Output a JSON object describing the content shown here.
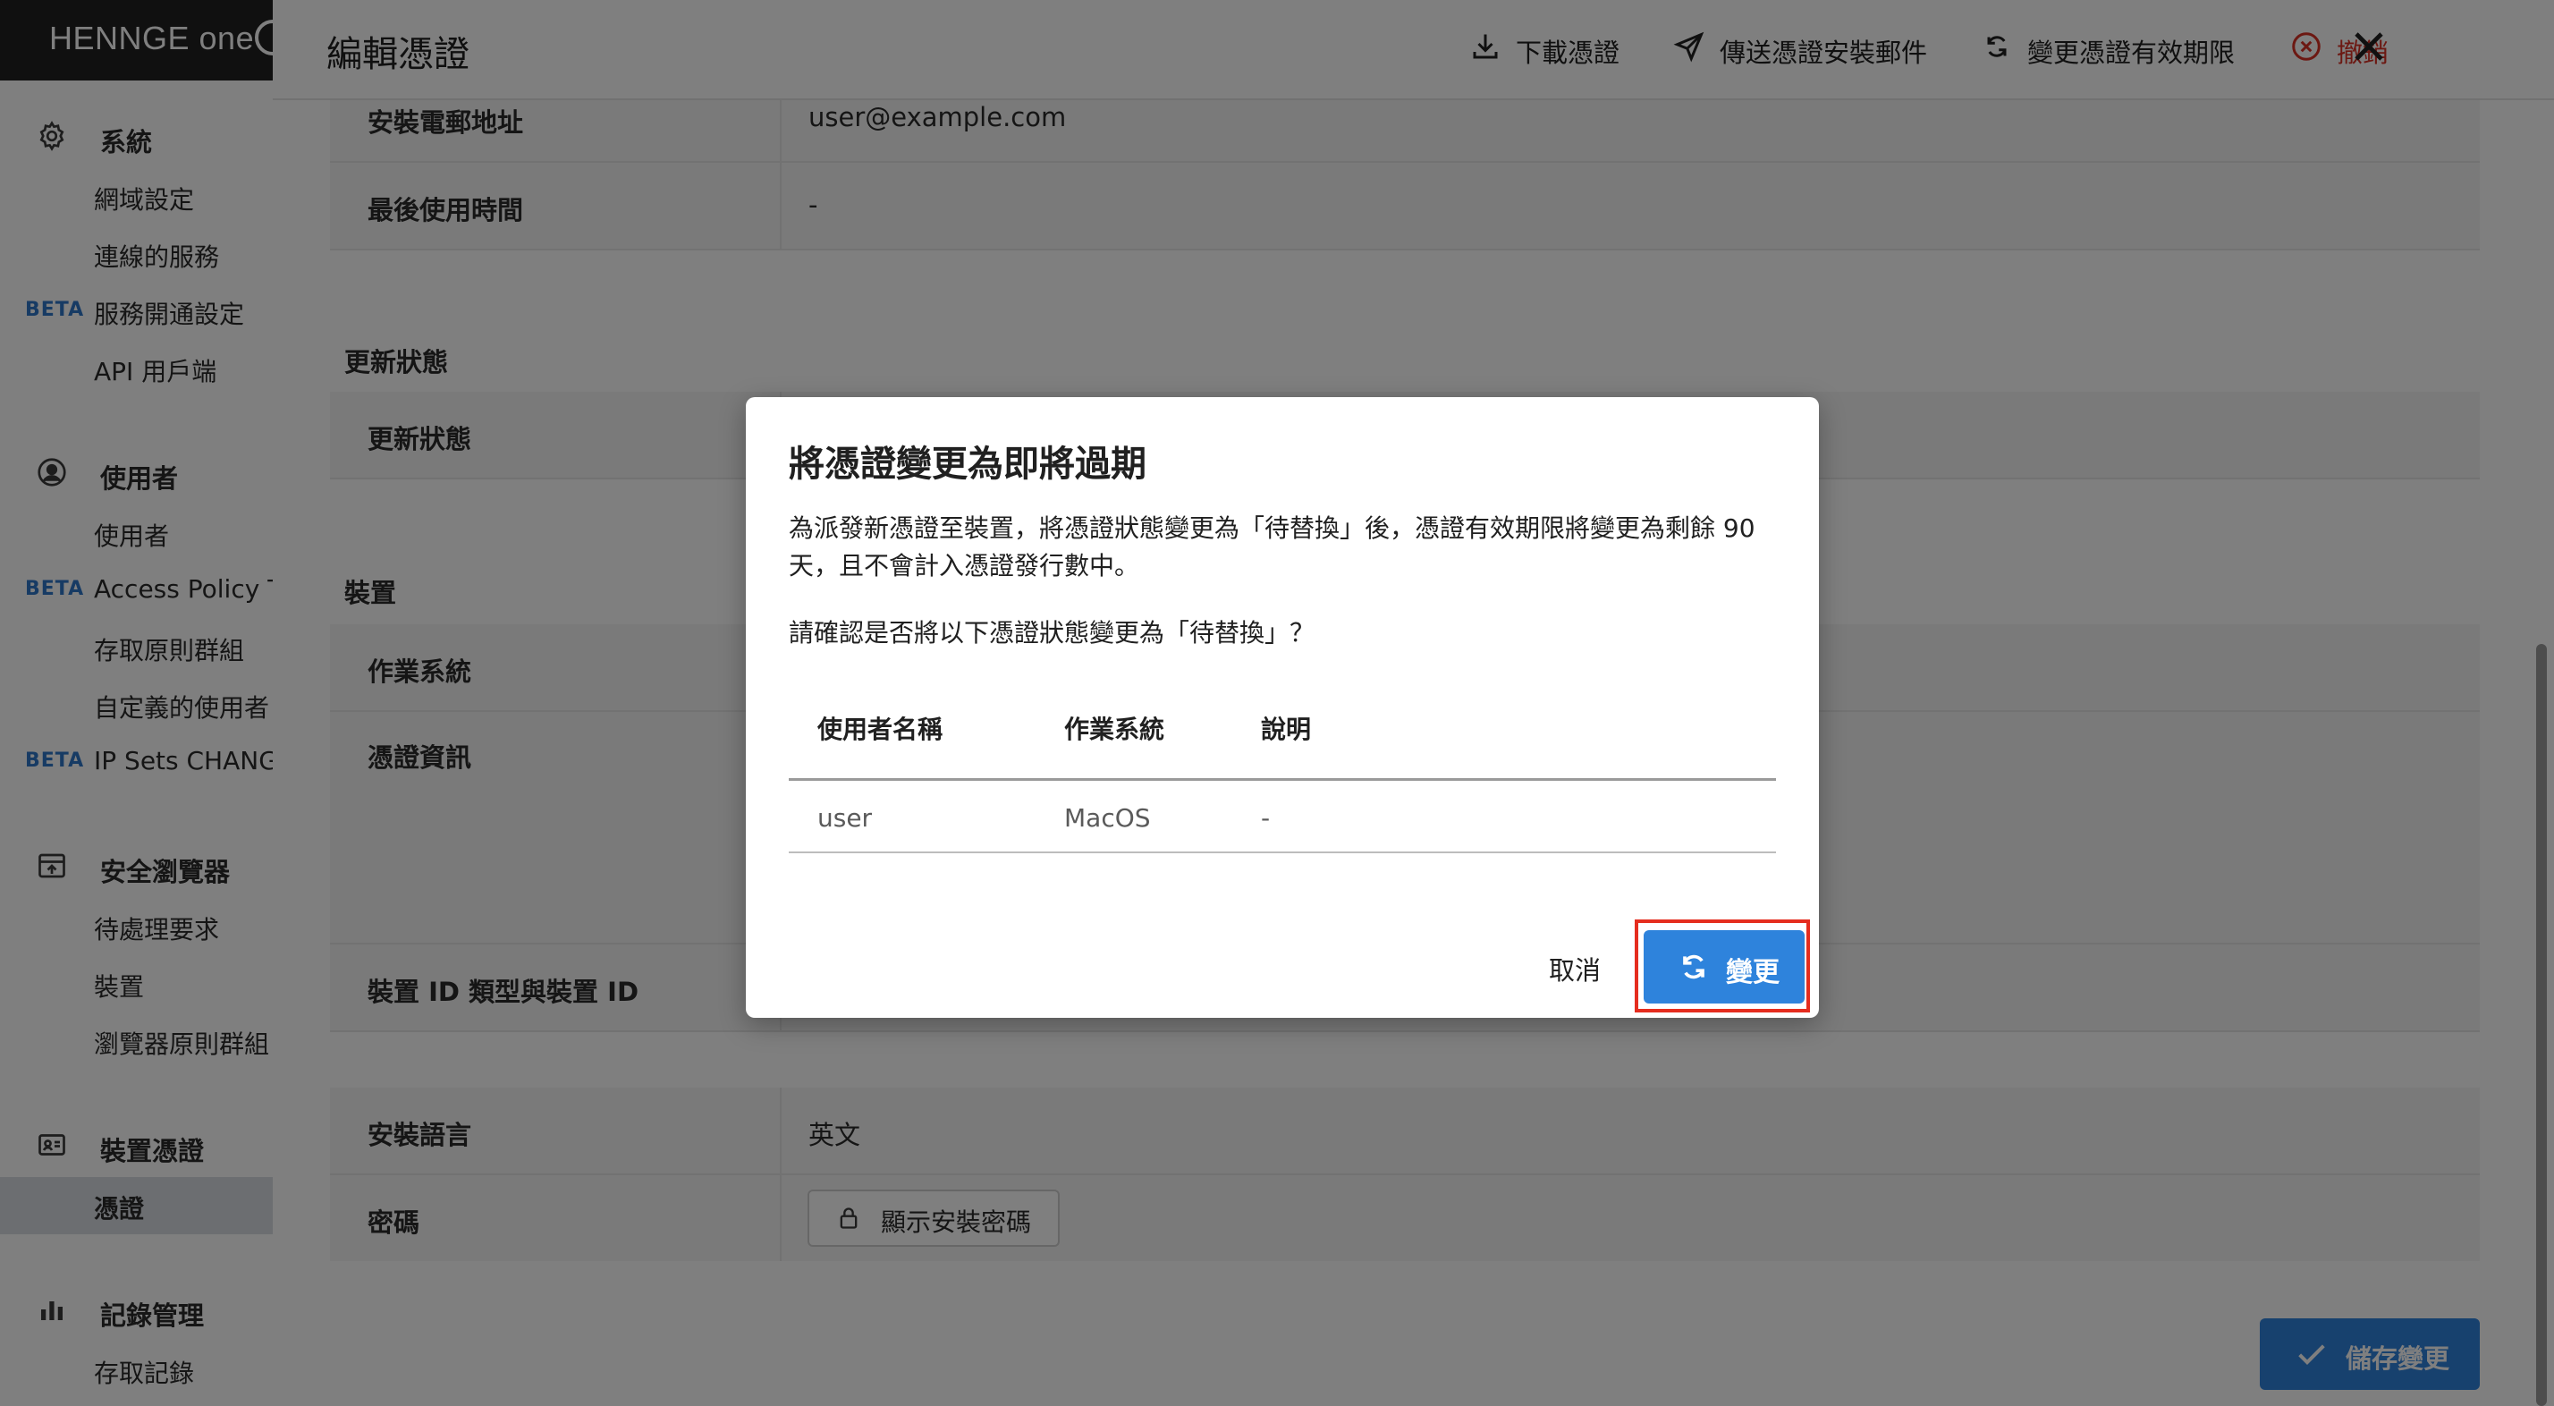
{
  "app": {
    "logo_text": "HENNGE one"
  },
  "sidebar": {
    "sections": [
      {
        "id": "system",
        "label": "系統",
        "icon": "gear-icon",
        "items": [
          {
            "label": "網域設定",
            "beta": ""
          },
          {
            "label": "連線的服務",
            "beta": ""
          },
          {
            "label": "服務開通設定",
            "beta": "BETA"
          },
          {
            "label": "API 用戶端",
            "beta": ""
          }
        ]
      },
      {
        "id": "users",
        "label": "使用者",
        "icon": "user-circle-icon",
        "items": [
          {
            "label": "使用者",
            "beta": ""
          },
          {
            "label": "Access Policy Te",
            "beta": "BETA"
          },
          {
            "label": "存取原則群組",
            "beta": ""
          },
          {
            "label": "自定義的使用者",
            "beta": ""
          },
          {
            "label": "IP Sets CHANGE",
            "beta": "BETA"
          }
        ]
      },
      {
        "id": "secure-browser",
        "label": "安全瀏覽器",
        "icon": "browser-icon",
        "items": [
          {
            "label": "待處理要求",
            "beta": ""
          },
          {
            "label": "裝置",
            "beta": ""
          },
          {
            "label": "瀏覽器原則群組",
            "beta": ""
          }
        ]
      },
      {
        "id": "device-cert",
        "label": "裝置憑證",
        "icon": "id-card-icon",
        "items": [
          {
            "label": "憑證",
            "beta": "",
            "active": true
          }
        ]
      },
      {
        "id": "logs",
        "label": "記錄管理",
        "icon": "bar-chart-icon",
        "items": [
          {
            "label": "存取記錄",
            "beta": ""
          }
        ]
      }
    ]
  },
  "page": {
    "title": "編輯憑證",
    "actions": {
      "download": "下載憑證",
      "send_mail": "傳送憑證安裝郵件",
      "change_validity": "變更憑證有效期限",
      "revoke": "撤銷"
    },
    "fields_top": [
      {
        "key": "安裝電郵地址",
        "value": "user@example.com"
      },
      {
        "key": "最後使用時間",
        "value": "-"
      }
    ],
    "update_status_section": "更新狀態",
    "update_status_row": {
      "key": "更新狀態",
      "value": ""
    },
    "device_section": "裝置",
    "device_rows": [
      {
        "key": "作業系統",
        "value": ""
      },
      {
        "key": "憑證資訊",
        "value": ""
      },
      {
        "key": "裝置 ID 類型與裝置 ID",
        "value": ""
      }
    ],
    "install_rows": [
      {
        "key": "安裝語言",
        "value": "英文"
      },
      {
        "key": "密碼",
        "value": ""
      }
    ],
    "show_password_button": "顯示安裝密碼",
    "save_button": "儲存變更"
  },
  "dialog": {
    "title": "將憑證變更為即將過期",
    "description": "為派發新憑證至裝置，將憑證狀態變更為「待替換」後，憑證有效期限將變更為剩餘 90 天，且不會計入憑證發行數中。",
    "confirm_text": "請確認是否將以下憑證狀態變更為「待替換」？",
    "table": {
      "headers": [
        "使用者名稱",
        "作業系統",
        "說明"
      ],
      "rows": [
        [
          "user",
          "MacOS",
          "-"
        ]
      ]
    },
    "cancel_label": "取消",
    "confirm_label": "變更"
  },
  "colors": {
    "primary": "#2e83dc",
    "danger": "#d93025",
    "highlight": "#e52d1f",
    "beta": "#2e77c9"
  }
}
